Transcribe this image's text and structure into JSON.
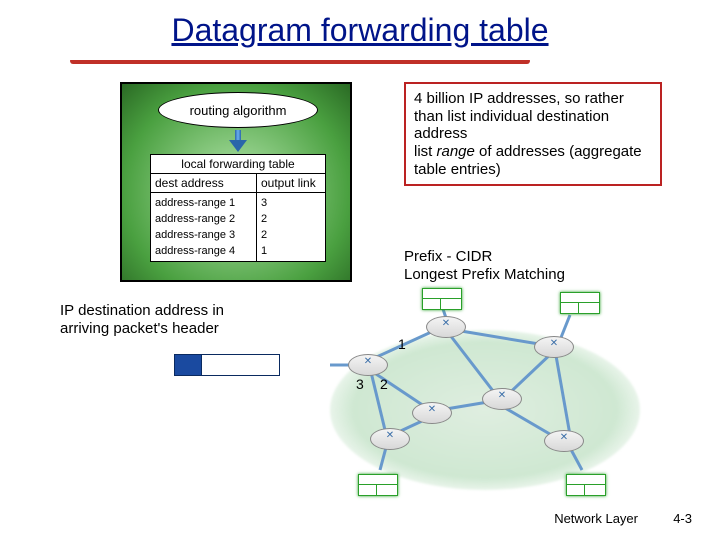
{
  "title": "Datagram forwarding table",
  "router": {
    "algo_label": "routing algorithm",
    "table_title": "local forwarding table",
    "col_dest": "dest address",
    "col_out": "output link",
    "rows": [
      {
        "dest": "address-range 1",
        "out": "3"
      },
      {
        "dest": "address-range 2",
        "out": "2"
      },
      {
        "dest": "address-range 3",
        "out": "2"
      },
      {
        "dest": "address-range 4",
        "out": "1"
      }
    ]
  },
  "callout": {
    "line1": "4 billion IP addresses, so rather than list individual destination address",
    "line2a": "list ",
    "line2b": "range",
    "line2c": " of addresses (aggregate table entries)"
  },
  "prefix_note": {
    "l1": "Prefix - CIDR",
    "l2": "Longest Prefix Matching"
  },
  "packet_note": {
    "l1": "IP destination address in",
    "l2": "arriving packet's header"
  },
  "ports": {
    "p1": "1",
    "p2": "2",
    "p3": "3"
  },
  "footer": {
    "chapter": "Network Layer",
    "page": "4-3"
  }
}
